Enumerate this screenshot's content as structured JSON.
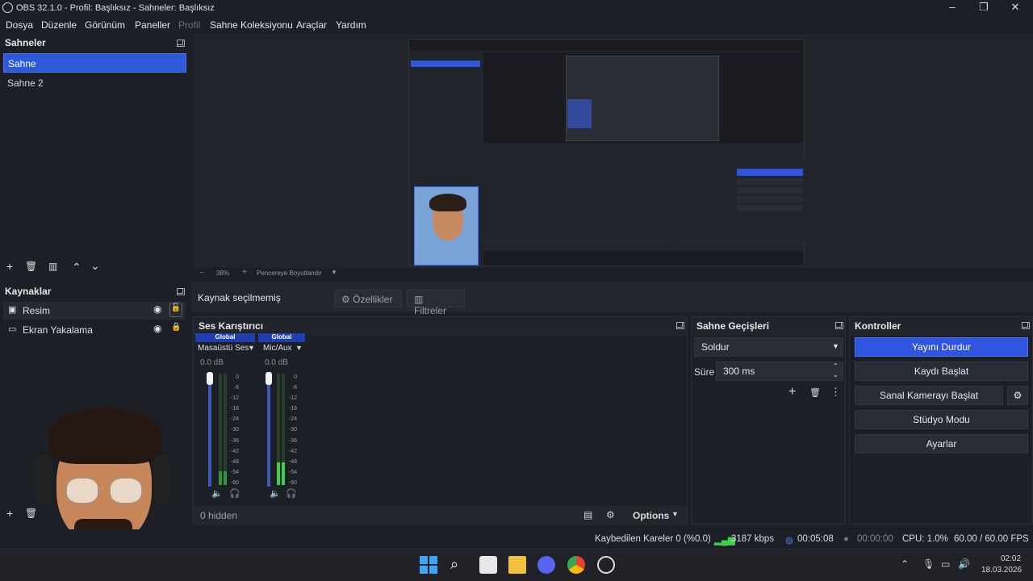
{
  "window": {
    "title": "OBS 32.1.0 - Profil: Başlıksız - Sahneler: Başlıksız"
  },
  "menu": [
    "Dosya",
    "Düzenle",
    "Görünüm",
    "Paneller",
    "Profil",
    "Sahne Koleksiyonu",
    "Araçlar",
    "Yardım"
  ],
  "scenes": {
    "title": "Sahneler",
    "items": [
      "Sahne",
      "Sahne 2"
    ],
    "selected": "Sahne"
  },
  "sources": {
    "title": "Kaynaklar",
    "items": [
      "Resim",
      "Ekran Yakalama"
    ]
  },
  "preview": {
    "zoom": "38%",
    "zoom_mode": "Pencereye Boyutlandır"
  },
  "source_toolbar": {
    "status": "Kaynak seçilmemiş",
    "properties": "Özellikler",
    "filters": "Filtreler"
  },
  "mixer": {
    "title": "Ses Karıştırıcı",
    "channels": [
      {
        "tag": "Global",
        "name": "Masaüstü Ses",
        "db": "0.0 dB",
        "level": 0.12
      },
      {
        "tag": "Global",
        "name": "Mic/Aux",
        "db": "0.0 dB",
        "level": 0.2
      }
    ],
    "scale": [
      "0",
      "-6",
      "-12",
      "-18",
      "-24",
      "-30",
      "-36",
      "-42",
      "-48",
      "-54",
      "-60"
    ],
    "hidden": "0 hidden",
    "options": "Options"
  },
  "transitions": {
    "title": "Sahne Geçişleri",
    "type": "Soldur",
    "duration_label": "Süre",
    "duration": "300 ms"
  },
  "controls": {
    "title": "Kontroller",
    "stop_stream": "Yayını Durdur",
    "start_record": "Kaydı Başlat",
    "virtual_cam": "Sanal Kamerayı Başlat",
    "studio": "Stüdyo Modu",
    "settings": "Ayarlar"
  },
  "status": {
    "dropped": "Kaybedilen Kareler 0 (%0.0)",
    "bitrate": "3187 kbps",
    "stream_time": "00:05:08",
    "record_time": "00:00:00",
    "cpu": "CPU: 1.0%",
    "fps": "60.00 / 60.00 FPS"
  },
  "taskbar": {
    "time": "02:02",
    "date": "18.03.2026"
  },
  "colors": {
    "accent": "#2f55e0",
    "bg": "#1d1f26",
    "meter_green": "#2c9a3a",
    "meter_red": "#8a2020",
    "live": "#3ecf4f"
  }
}
